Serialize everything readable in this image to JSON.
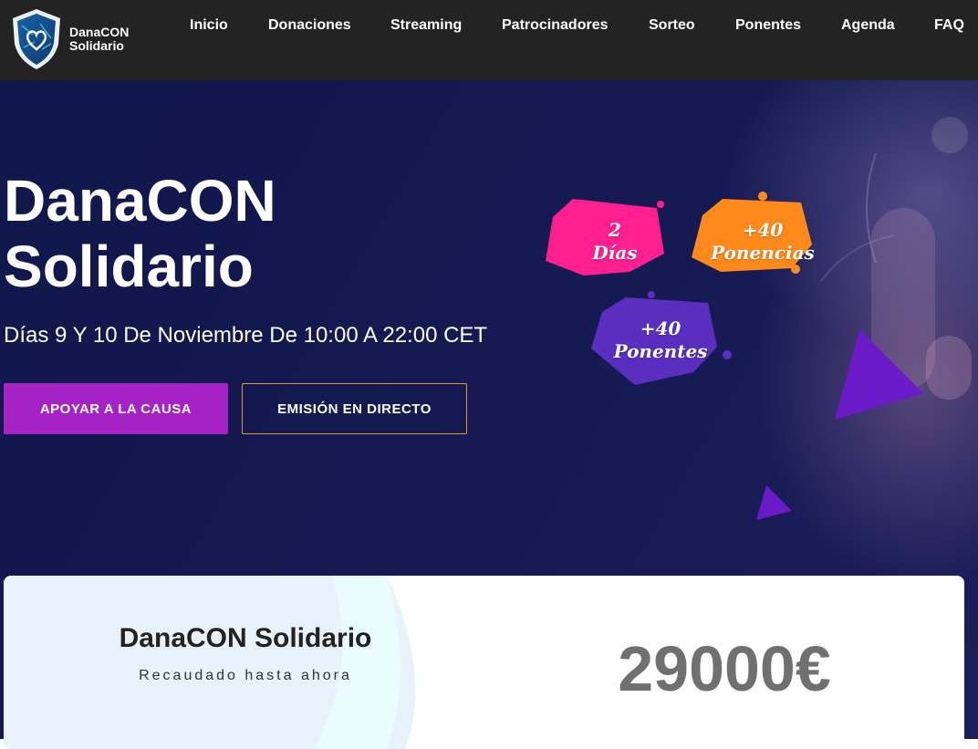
{
  "brand": {
    "name_line1": "DanaCON",
    "name_line2": "Solidario"
  },
  "nav": {
    "items": [
      "Inicio",
      "Donaciones",
      "Streaming",
      "Patrocinadores",
      "Sorteo",
      "Ponentes",
      "Agenda",
      "FAQ"
    ]
  },
  "hero": {
    "title_line1": "DanaCON",
    "title_line2": "Solidario",
    "subtitle": "Días 9 Y 10 De Noviembre De 10:00 A 22:00 CET",
    "cta_primary": "APOYAR A LA CAUSA",
    "cta_secondary": "EMISIÓN EN DIRECTO",
    "badges": [
      {
        "line1": "2",
        "line2": "Días",
        "color": "#ff1f8e"
      },
      {
        "line1": "+40",
        "line2": "Ponencias",
        "color": "#ff8a1c"
      },
      {
        "line1": "+40",
        "line2": "Ponentes",
        "color": "#5a2fc0"
      }
    ]
  },
  "donation": {
    "title": "DanaCON Solidario",
    "subtitle": "Recaudado hasta ahora",
    "amount": "29000€"
  },
  "colors": {
    "header_bg": "#232323",
    "hero_bg": "#151a52",
    "primary": "#a523c4",
    "outline": "#e8923a"
  }
}
